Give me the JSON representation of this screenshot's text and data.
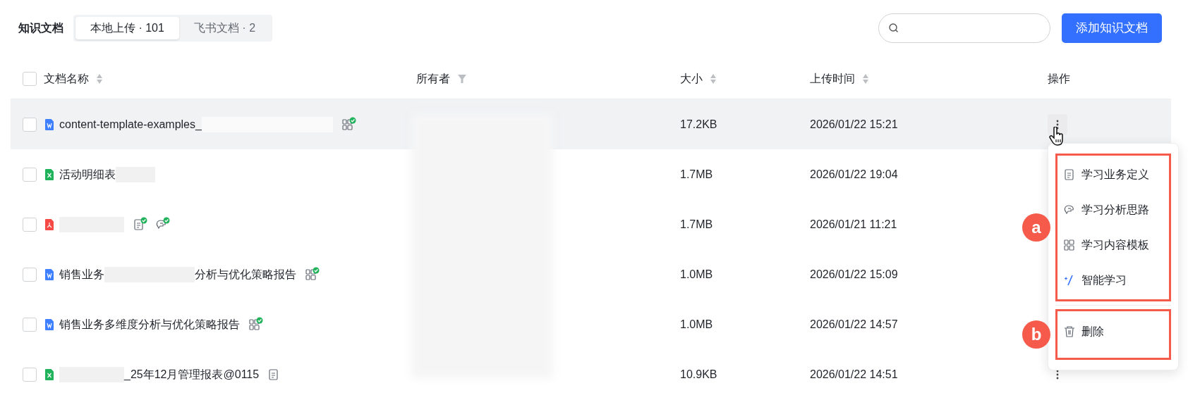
{
  "header": {
    "title": "知识文档",
    "tabs": [
      {
        "label": "本地上传 · 101",
        "selected": true
      },
      {
        "label": "飞书文档 · 2",
        "selected": false
      }
    ],
    "add_button": "添加知识文档"
  },
  "table": {
    "select_all": {
      "checked": false
    },
    "columns": [
      {
        "label": "文档名称",
        "kind": "sort"
      },
      {
        "label": "所有者",
        "kind": "filter"
      },
      {
        "label": "大小",
        "kind": "sort"
      },
      {
        "label": "上传时间",
        "kind": "sort"
      },
      {
        "label": "操作",
        "kind": "plain"
      }
    ],
    "owner_column": {
      "kind": "redacted"
    },
    "rows": [
      {
        "checked": false,
        "kind": "word",
        "hovered": true,
        "name": [
          {
            "kind": "text",
            "text": "content-template-examples_"
          },
          {
            "kind": "redacted-xl"
          }
        ],
        "badges": [
          {
            "kind": "template",
            "checked": true
          }
        ],
        "size": "17.2KB",
        "uploaded": "2026/01/22 15:21",
        "actions_visible": true
      },
      {
        "checked": false,
        "kind": "excel",
        "hovered": false,
        "name": [
          {
            "kind": "text",
            "text": "活动明细表"
          },
          {
            "kind": "redacted-s"
          }
        ],
        "badges": [],
        "size": "1.7MB",
        "uploaded": "2026/01/22 19:04",
        "actions_visible": false
      },
      {
        "checked": false,
        "kind": "pdf",
        "hovered": false,
        "name": [
          {
            "kind": "redacted-m"
          }
        ],
        "badges": [
          {
            "kind": "definition",
            "checked": true
          },
          {
            "kind": "analysis",
            "checked": true
          }
        ],
        "size": "1.7MB",
        "uploaded": "2026/01/21 11:21",
        "actions_visible": false
      },
      {
        "checked": false,
        "kind": "word",
        "hovered": false,
        "name": [
          {
            "kind": "text",
            "text": "销售业务"
          },
          {
            "kind": "redacted-l"
          },
          {
            "kind": "text",
            "text": "分析与优化策略报告"
          }
        ],
        "badges": [
          {
            "kind": "template",
            "checked": true
          }
        ],
        "size": "1.0MB",
        "uploaded": "2026/01/22 15:09",
        "actions_visible": false
      },
      {
        "checked": false,
        "kind": "word",
        "hovered": false,
        "name": [
          {
            "kind": "text",
            "text": "销售业务多维度分析与优化策略报告"
          }
        ],
        "badges": [
          {
            "kind": "template",
            "checked": true
          }
        ],
        "size": "1.0MB",
        "uploaded": "2026/01/22 14:57",
        "actions_visible": false
      },
      {
        "checked": false,
        "kind": "excel",
        "hovered": false,
        "name": [
          {
            "kind": "redacted-m"
          },
          {
            "kind": "text",
            "text": "_25年12月管理报表@0115"
          }
        ],
        "badges": [
          {
            "kind": "definition",
            "checked": false
          }
        ],
        "size": "10.9KB",
        "uploaded": "2026/01/22 14:51",
        "actions_visible": true
      }
    ]
  },
  "menu": {
    "groups": [
      {
        "annotation": "a",
        "items": [
          {
            "kind": "definition",
            "label": "学习业务定义"
          },
          {
            "kind": "analysis",
            "label": "学习分析思路"
          },
          {
            "kind": "template",
            "label": "学习内容模板"
          },
          {
            "kind": "sparkle",
            "label": "智能学习"
          }
        ]
      },
      {
        "annotation": "b",
        "items": [
          {
            "kind": "trash",
            "label": "删除"
          }
        ]
      }
    ]
  }
}
